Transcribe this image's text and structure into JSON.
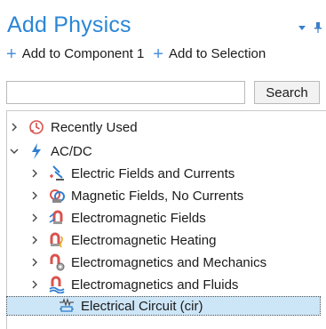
{
  "panel": {
    "title": "Add Physics",
    "actions": [
      {
        "label": "Add to Component 1",
        "icon": "plus-icon"
      },
      {
        "label": "Add to Selection",
        "icon": "plus-icon"
      }
    ]
  },
  "search": {
    "value": "",
    "placeholder": "",
    "button_label": "Search"
  },
  "tree": {
    "items": [
      {
        "label": "Recently Used",
        "icon": "clock-icon",
        "expanded": false
      },
      {
        "label": "AC/DC",
        "icon": "acdc-icon",
        "expanded": true
      },
      {
        "label": "Electric Fields and Currents",
        "icon": "electric-fields-icon"
      },
      {
        "label": "Magnetic Fields, No Currents",
        "icon": "magnetic-fields-icon"
      },
      {
        "label": "Electromagnetic Fields",
        "icon": "electromagnetic-fields-icon"
      },
      {
        "label": "Electromagnetic Heating",
        "icon": "electromagnetic-heating-icon"
      },
      {
        "label": "Electromagnetics and Mechanics",
        "icon": "electromagnetics-mechanics-icon"
      },
      {
        "label": "Electromagnetics and Fluids",
        "icon": "electromagnetics-fluids-icon"
      },
      {
        "label": "Electrical Circuit (cir)",
        "icon": "electrical-circuit-icon",
        "selected": true
      }
    ]
  },
  "colors": {
    "accent": "#2a86d6",
    "selection": "#cde6f7"
  }
}
